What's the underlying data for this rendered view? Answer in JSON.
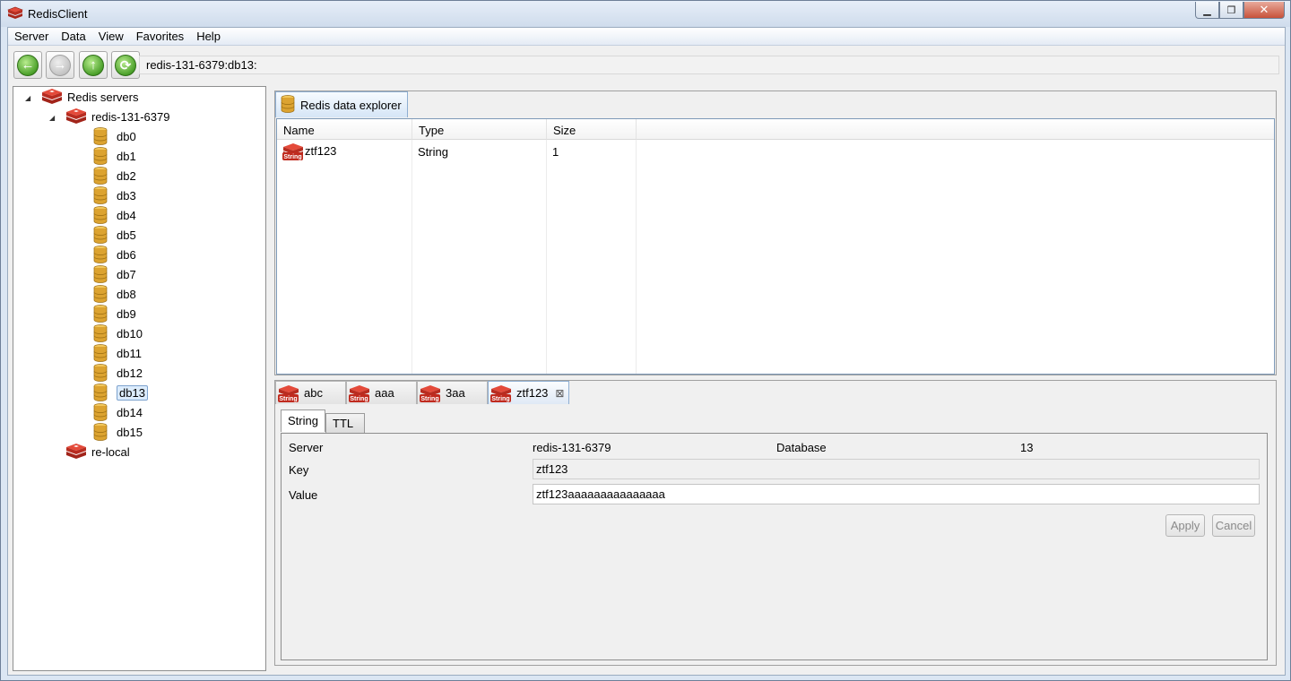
{
  "window": {
    "title": "RedisClient"
  },
  "menu": [
    "Server",
    "Data",
    "View",
    "Favorites",
    "Help"
  ],
  "toolbar": {
    "address": "redis-131-6379:db13:"
  },
  "tree": {
    "root": "Redis servers",
    "server": "redis-131-6379",
    "databases": [
      "db0",
      "db1",
      "db2",
      "db3",
      "db4",
      "db5",
      "db6",
      "db7",
      "db8",
      "db9",
      "db10",
      "db11",
      "db12",
      "db13",
      "db14",
      "db15"
    ],
    "selected": "db13",
    "other_server": "re-local"
  },
  "explorer": {
    "tab_label": "Redis data explorer",
    "columns": [
      "Name",
      "Type",
      "Size"
    ],
    "rows": [
      {
        "name": "ztf123",
        "type": "String",
        "size": "1"
      }
    ]
  },
  "editor": {
    "tabs": [
      "abc",
      "aaa",
      "3aa",
      "ztf123"
    ],
    "active_tab": "ztf123",
    "inner_tabs": [
      "String",
      "TTL"
    ],
    "labels": {
      "server": "Server",
      "database": "Database",
      "key": "Key",
      "value": "Value"
    },
    "server_value": "redis-131-6379",
    "database_value": "13",
    "key_value": "ztf123",
    "value_value": "ztf123aaaaaaaaaaaaaaa",
    "apply_label": "Apply",
    "cancel_label": "Cancel"
  },
  "icons": {
    "string_badge": "String"
  },
  "colors": {
    "redis_red": "#c9302c",
    "db_gold": "#d9a22c",
    "selection": "#dcecfc"
  }
}
